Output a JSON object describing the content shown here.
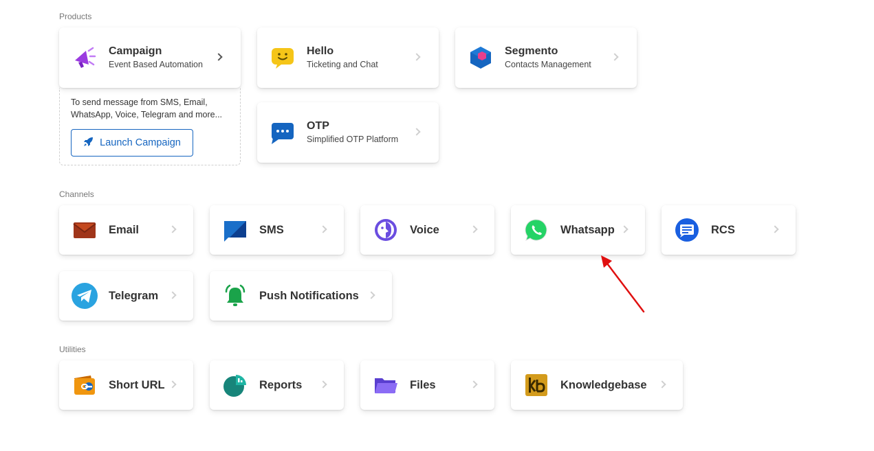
{
  "sections": {
    "products": "Products",
    "channels": "Channels",
    "utilities": "Utilities"
  },
  "products": {
    "campaign": {
      "title": "Campaign",
      "subtitle": "Event Based Automation",
      "icon": "megaphone-icon",
      "description": "To send message from SMS, Email, WhatsApp, Voice, Telegram and more...",
      "launch_label": "Launch Campaign"
    },
    "hello": {
      "title": "Hello",
      "subtitle": "Ticketing and Chat",
      "icon": "smiley-chat-icon"
    },
    "segmento": {
      "title": "Segmento",
      "subtitle": "Contacts Management",
      "icon": "hexagon-cube-icon"
    },
    "otp": {
      "title": "OTP",
      "subtitle": "Simplified OTP Platform",
      "icon": "chat-bubble-dots-icon"
    }
  },
  "channels": {
    "email": {
      "title": "Email",
      "icon": "envelope-icon"
    },
    "sms": {
      "title": "SMS",
      "icon": "sms-bubble-icon"
    },
    "voice": {
      "title": "Voice",
      "icon": "voice-face-icon"
    },
    "whatsapp": {
      "title": "Whatsapp",
      "icon": "whatsapp-icon"
    },
    "rcs": {
      "title": "RCS",
      "icon": "rcs-message-icon"
    },
    "telegram": {
      "title": "Telegram",
      "icon": "telegram-icon"
    },
    "push": {
      "title": "Push Notifications",
      "icon": "bell-icon"
    }
  },
  "utilities": {
    "short_url": {
      "title": "Short URL",
      "icon": "link-wallet-icon"
    },
    "reports": {
      "title": "Reports",
      "icon": "pie-chart-icon"
    },
    "files": {
      "title": "Files",
      "icon": "folder-icon"
    },
    "knowledgebase": {
      "title": "Knowledgebase",
      "icon": "kb-book-icon"
    }
  },
  "colors": {
    "primary": "#1565c0",
    "campaign_purple": "#9b3be0",
    "hello_yellow": "#f5c518",
    "segmento_blue": "#1565c0",
    "segmento_pink": "#e83e8c",
    "email_brown": "#a0351a",
    "whatsapp_green": "#25d366",
    "telegram_blue": "#2aa3e0",
    "push_green": "#1aa34a",
    "reports_teal": "#17857a",
    "files_purple": "#7b5cf0",
    "kb_gold": "#d39b1c",
    "annotation_red": "#e01010"
  }
}
